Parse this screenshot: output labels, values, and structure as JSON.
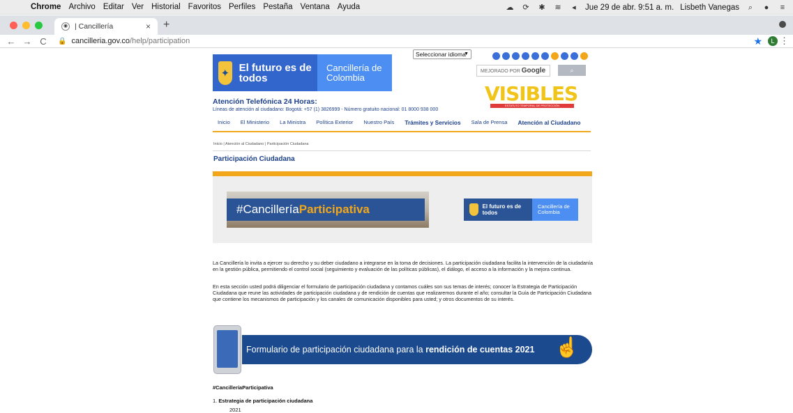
{
  "menubar": {
    "app": "Chrome",
    "items": [
      "Archivo",
      "Editar",
      "Ver",
      "Historial",
      "Favoritos",
      "Perfiles",
      "Pestaña",
      "Ventana",
      "Ayuda"
    ],
    "clock": "Jue 29 de abr. 9:51 a. m.",
    "user": "Lisbeth Vanegas"
  },
  "tab": {
    "title": "| Cancillería",
    "close": "×",
    "new": "+"
  },
  "toolbar": {
    "url_host": "cancilleria.gov.co",
    "url_path": "/help/participation"
  },
  "header": {
    "brand_left": "El futuro es de todos",
    "brand_right": "Cancillería de Colombia",
    "language_select": "Seleccionar idioma",
    "search_powered": "MEJORADO POR",
    "search_brand": "Google",
    "visibles_logo": "VISIBLES",
    "visibles_strip": "ESTATUTO TEMPORAL DE PROTECCIÓN",
    "phone_title": "Atención Telefónica 24 Horas:",
    "phone_lines": "Líneas de atención al ciudadano: Bogotá: +57 (1) 3826999 - Número gratuito nacional: 01 8000 938 000"
  },
  "nav": [
    {
      "label": "Inicio"
    },
    {
      "label": "El Ministerio"
    },
    {
      "label": "La Ministra"
    },
    {
      "label": "Política Exterior"
    },
    {
      "label": "Nuestro País"
    },
    {
      "label": "Trámites y Servicios"
    },
    {
      "label": "Sala de Prensa"
    },
    {
      "label": "Atención al Ciudadano"
    }
  ],
  "breadcrumb": "Inicio | Atención al Ciudadano | Participación Ciudadana",
  "page_title": "Participación Ciudadana",
  "banner": {
    "hashtag_prefix": "#Cancillería",
    "hashtag_accent": "Participativa",
    "mini_left": "El futuro es de todos",
    "mini_right": "Cancillería de Colombia"
  },
  "body": {
    "p1": "La Cancillería lo invita a ejercer su derecho y su deber ciudadano a integrarse en la toma de decisiones. La participación ciudadana facilita la intervención de la ciudadanía en la gestión pública, permitiendo el control social (seguimiento y evaluación de las políticas públicas), el diálogo, el acceso a la información y la mejora continua.",
    "p2": "En esta sección usted podrá diligenciar el formulario de participación ciudadana y contamos cuáles son sus temas de interés; conocer la Estrategia de Participación Ciudadana que reune las actividades de participación ciudadana y de rendición de cuentas que realizaremos durante el año; consultar la Guía de Participación Ciudadana que contiene los mecanismos de participación y los canales de comunicación disponibles para usted; y otros documentos de su interés."
  },
  "cta": {
    "text": "Formulario de participación ciudadana para la",
    "bold": "rendición de cuentas 2021"
  },
  "hashtag": "#CancilleríaParticipativa",
  "list": {
    "item1_num": "1.",
    "item1_label": "Estrategia de participación ciudadana",
    "year": "2021"
  },
  "colors": {
    "brand_blue": "#3366cc",
    "brand_light_blue": "#4d8ef2",
    "nav_text": "#1b3f8b",
    "accent_orange": "#f2a71b"
  },
  "social_icons": [
    "twitter-icon",
    "instagram-icon",
    "facebook-icon",
    "flickr-icon",
    "youtube-icon",
    "sound-icon",
    "rss-icon",
    "maps-icon",
    "email-icon",
    "web-icon"
  ]
}
